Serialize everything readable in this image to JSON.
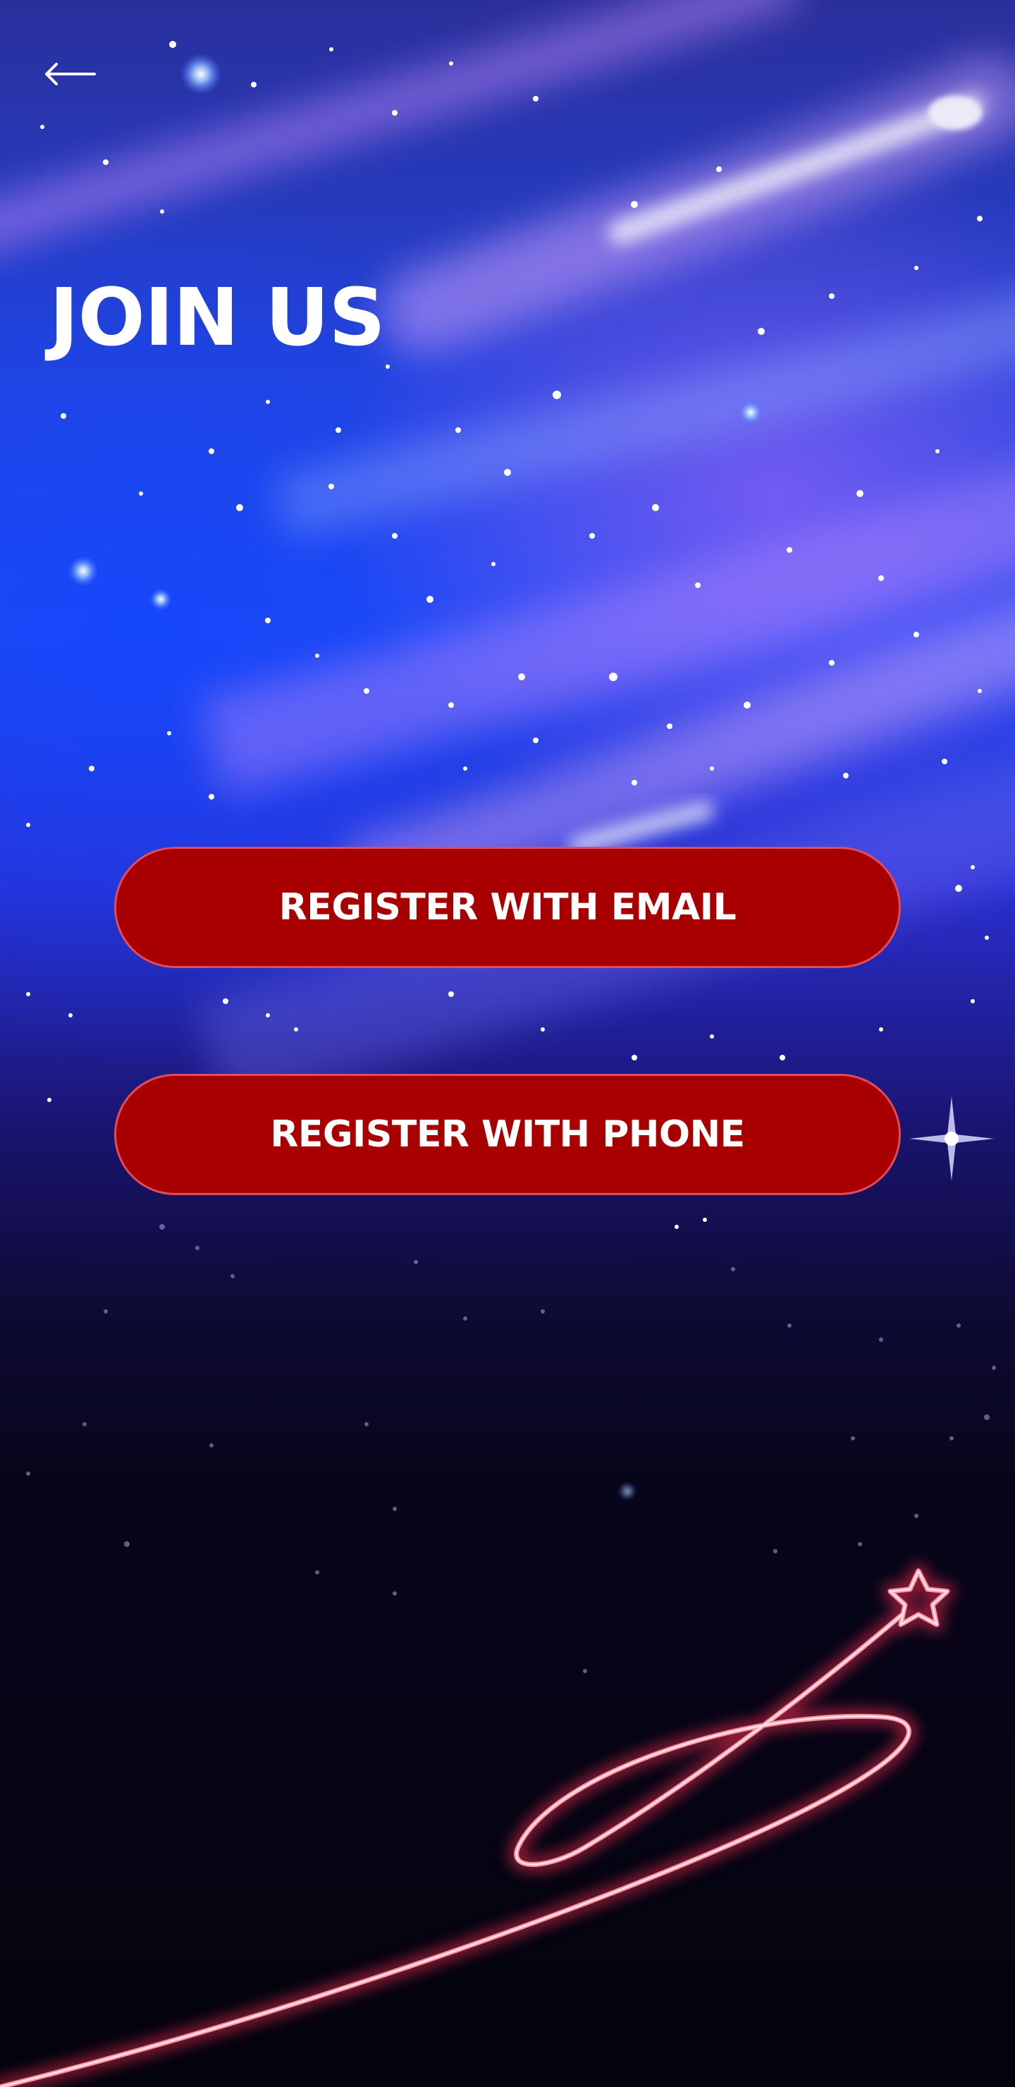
{
  "header": {
    "back_icon": "arrow-left-icon"
  },
  "main": {
    "title": "JOIN US",
    "buttons": {
      "email_label": "REGISTER WITH EMAIL",
      "phone_label": "REGISTER WITH PHONE"
    }
  },
  "colors": {
    "button_fill": "#a80000",
    "button_border": "#e14b5c",
    "text": "#ffffff"
  }
}
